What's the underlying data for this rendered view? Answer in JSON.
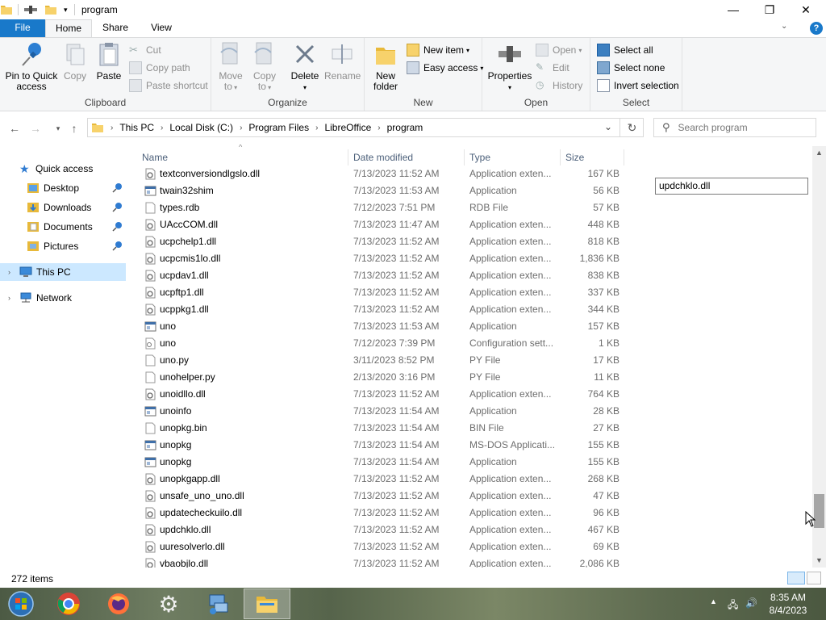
{
  "window": {
    "title": "program",
    "minimize": "—",
    "maximize": "❐",
    "close": "✕"
  },
  "tabs": [
    "File",
    "Home",
    "Share",
    "View"
  ],
  "ribbon": {
    "clipboard": {
      "label": "Clipboard",
      "pin": [
        "Pin to Quick",
        "access"
      ],
      "copy": "Copy",
      "paste": "Paste",
      "cut": "Cut",
      "copy_path": "Copy path",
      "paste_shortcut": "Paste shortcut"
    },
    "organize": {
      "label": "Organize",
      "move_to": [
        "Move",
        "to"
      ],
      "copy_to": [
        "Copy",
        "to"
      ],
      "delete": "Delete",
      "rename": "Rename"
    },
    "new": {
      "label": "New",
      "new_folder": [
        "New",
        "folder"
      ],
      "new_item": "New item",
      "easy_access": "Easy access"
    },
    "open": {
      "label": "Open",
      "properties": "Properties",
      "open": "Open",
      "edit": "Edit",
      "history": "History"
    },
    "select": {
      "label": "Select",
      "select_all": "Select all",
      "select_none": "Select none",
      "invert": "Invert selection"
    }
  },
  "address": {
    "crumbs": [
      "This PC",
      "Local Disk (C:)",
      "Program Files",
      "LibreOffice",
      "program"
    ],
    "search_placeholder": "Search program"
  },
  "nav": {
    "quick_access": "Quick access",
    "items": [
      "Desktop",
      "Downloads",
      "Documents",
      "Pictures"
    ],
    "this_pc": "This PC",
    "network": "Network"
  },
  "columns": {
    "name": "Name",
    "date": "Date modified",
    "type": "Type",
    "size": "Size"
  },
  "files": [
    {
      "name": "textconversiondlgslo.dll",
      "date": "7/13/2023 11:52 AM",
      "type": "Application exten...",
      "size": "167 KB",
      "icon": "dll"
    },
    {
      "name": "twain32shim",
      "date": "7/13/2023 11:53 AM",
      "type": "Application",
      "size": "56 KB",
      "icon": "exe"
    },
    {
      "name": "types.rdb",
      "date": "7/12/2023 7:51 PM",
      "type": "RDB File",
      "size": "57 KB",
      "icon": "file"
    },
    {
      "name": "UAccCOM.dll",
      "date": "7/13/2023 11:47 AM",
      "type": "Application exten...",
      "size": "448 KB",
      "icon": "dll"
    },
    {
      "name": "ucpchelp1.dll",
      "date": "7/13/2023 11:52 AM",
      "type": "Application exten...",
      "size": "818 KB",
      "icon": "dll"
    },
    {
      "name": "ucpcmis1lo.dll",
      "date": "7/13/2023 11:52 AM",
      "type": "Application exten...",
      "size": "1,836 KB",
      "icon": "dll"
    },
    {
      "name": "ucpdav1.dll",
      "date": "7/13/2023 11:52 AM",
      "type": "Application exten...",
      "size": "838 KB",
      "icon": "dll"
    },
    {
      "name": "ucpftp1.dll",
      "date": "7/13/2023 11:52 AM",
      "type": "Application exten...",
      "size": "337 KB",
      "icon": "dll"
    },
    {
      "name": "ucppkg1.dll",
      "date": "7/13/2023 11:52 AM",
      "type": "Application exten...",
      "size": "344 KB",
      "icon": "dll"
    },
    {
      "name": "uno",
      "date": "7/13/2023 11:53 AM",
      "type": "Application",
      "size": "157 KB",
      "icon": "exe"
    },
    {
      "name": "uno",
      "date": "7/12/2023 7:39 PM",
      "type": "Configuration sett...",
      "size": "1 KB",
      "icon": "cfg"
    },
    {
      "name": "uno.py",
      "date": "3/11/2023 8:52 PM",
      "type": "PY File",
      "size": "17 KB",
      "icon": "file"
    },
    {
      "name": "unohelper.py",
      "date": "2/13/2020 3:16 PM",
      "type": "PY File",
      "size": "11 KB",
      "icon": "file"
    },
    {
      "name": "unoidllo.dll",
      "date": "7/13/2023 11:52 AM",
      "type": "Application exten...",
      "size": "764 KB",
      "icon": "dll"
    },
    {
      "name": "unoinfo",
      "date": "7/13/2023 11:54 AM",
      "type": "Application",
      "size": "28 KB",
      "icon": "exe"
    },
    {
      "name": "unopkg.bin",
      "date": "7/13/2023 11:54 AM",
      "type": "BIN File",
      "size": "27 KB",
      "icon": "file"
    },
    {
      "name": "unopkg",
      "date": "7/13/2023 11:54 AM",
      "type": "MS-DOS Applicati...",
      "size": "155 KB",
      "icon": "exe"
    },
    {
      "name": "unopkg",
      "date": "7/13/2023 11:54 AM",
      "type": "Application",
      "size": "155 KB",
      "icon": "exe"
    },
    {
      "name": "unopkgapp.dll",
      "date": "7/13/2023 11:52 AM",
      "type": "Application exten...",
      "size": "268 KB",
      "icon": "dll"
    },
    {
      "name": "unsafe_uno_uno.dll",
      "date": "7/13/2023 11:52 AM",
      "type": "Application exten...",
      "size": "47 KB",
      "icon": "dll"
    },
    {
      "name": "updatecheckuilo.dll",
      "date": "7/13/2023 11:52 AM",
      "type": "Application exten...",
      "size": "96 KB",
      "icon": "dll"
    },
    {
      "name": "updchklo.dll",
      "date": "7/13/2023 11:52 AM",
      "type": "Application exten...",
      "size": "467 KB",
      "icon": "dll"
    },
    {
      "name": "uuresolverlo.dll",
      "date": "7/13/2023 11:52 AM",
      "type": "Application exten...",
      "size": "69 KB",
      "icon": "dll"
    },
    {
      "name": "vbaobjlo.dll",
      "date": "7/13/2023 11:52 AM",
      "type": "Application exten...",
      "size": "2,086 KB",
      "icon": "dll"
    }
  ],
  "preview_field": "updchklo.dll",
  "status": {
    "items": "272 items"
  },
  "taskbar": {
    "time": "8:35 AM",
    "date": "8/4/2023",
    "apps": [
      "start-orb-icon",
      "chrome-icon",
      "firefox-icon",
      "settings-icon",
      "network-tool-icon",
      "file-explorer-icon"
    ]
  },
  "colors": {
    "file_tab": "#1979ca",
    "selected_nav": "#cce8ff",
    "ribbon_bg": "#f5f6f7"
  }
}
